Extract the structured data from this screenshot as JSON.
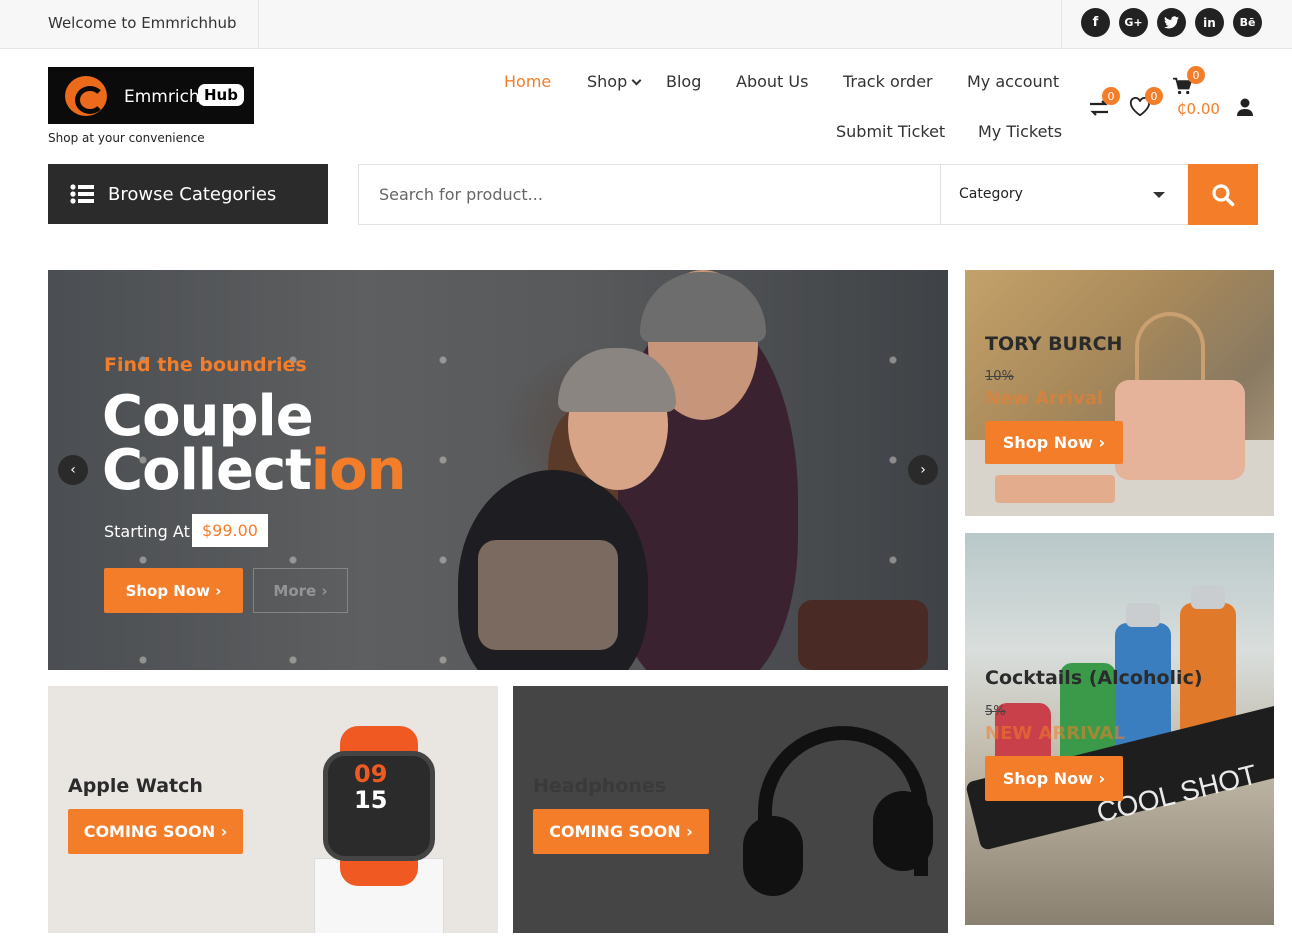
{
  "topbar": {
    "welcome": "Welcome to Emmrichhub",
    "socials": [
      {
        "icon": "facebook-icon",
        "glyph": "f"
      },
      {
        "icon": "google-plus-icon",
        "glyph": "G+"
      },
      {
        "icon": "twitter-icon",
        "glyph": "t"
      },
      {
        "icon": "linkedin-icon",
        "glyph": "in"
      },
      {
        "icon": "behance-icon",
        "glyph": "Bē"
      }
    ]
  },
  "logo": {
    "brand": "Emmrich",
    "hub": "Hub",
    "tagline": "Shop at your convenience"
  },
  "nav": {
    "home": "Home",
    "shop": "Shop",
    "blog": "Blog",
    "about": "About Us",
    "track": "Track order",
    "account": "My account",
    "submit_ticket": "Submit Ticket",
    "my_tickets": "My Tickets"
  },
  "header_icons": {
    "compare_count": "0",
    "wishlist_count": "0",
    "cart_count": "0",
    "cart_total": "₵0.00"
  },
  "browse": {
    "label": "Browse Categories"
  },
  "search": {
    "placeholder": "Search for product...",
    "category": "Category"
  },
  "hero": {
    "kicker": "Find the boundries",
    "title_line1": "Couple",
    "title_line2a": "Collect",
    "title_line2b": "ion",
    "starting": "Starting At",
    "price": "$99.00",
    "shop_btn": "Shop Now ›",
    "more_btn": "More ›"
  },
  "side1": {
    "title": "TORY BURCH",
    "discount": "10%",
    "tag": "New Arrival",
    "btn": "Shop Now ›"
  },
  "side2": {
    "title": "Cocktails (Alcoholic)",
    "discount": "5%",
    "tag": "NEW ARRIVAL",
    "btn": "Shop Now ›",
    "label": "COOL SHOT"
  },
  "banner1": {
    "title": "Apple Watch",
    "btn": "COMING SOON ›",
    "time_h": "09",
    "time_m": "15"
  },
  "banner2": {
    "title": "Headphones",
    "btn": "COMING SOON ›"
  },
  "colors": {
    "accent": "#f47d2a",
    "dark": "#2b2b2b"
  }
}
